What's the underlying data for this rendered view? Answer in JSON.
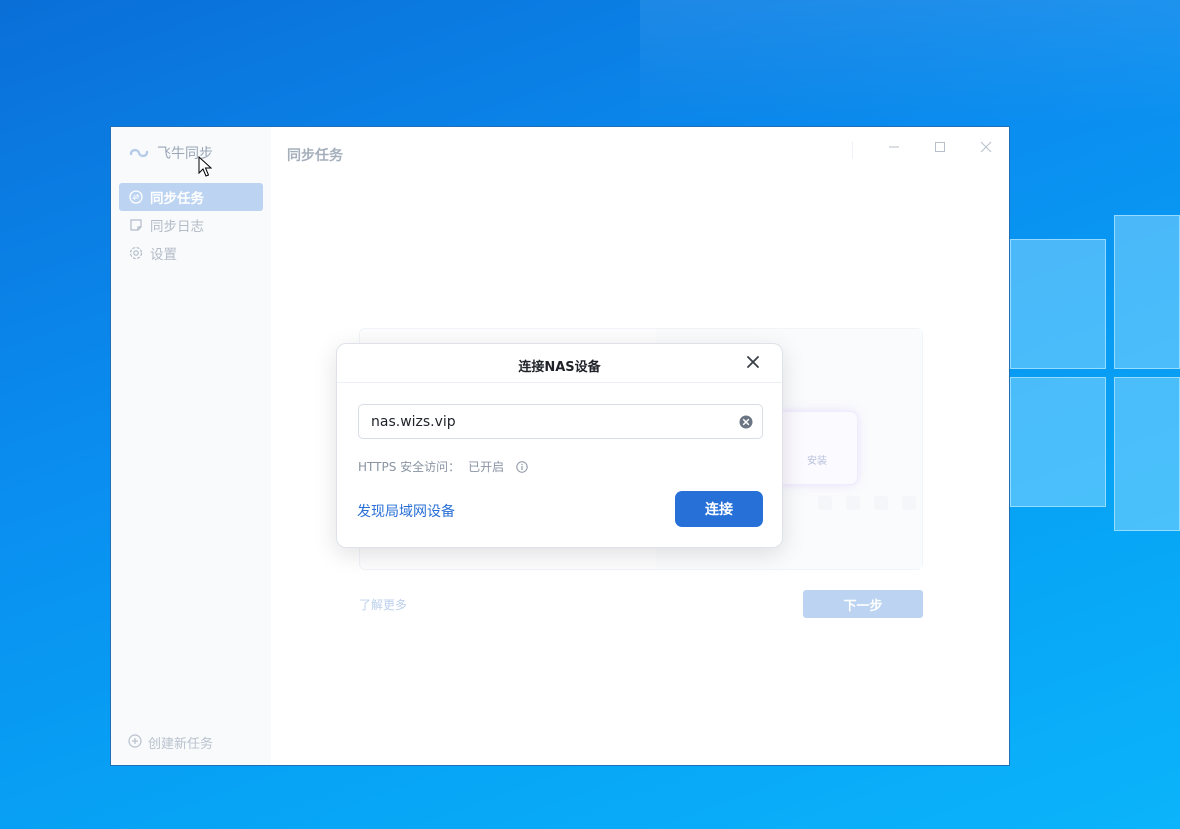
{
  "colors": {
    "accent": "#2670d8",
    "accent_light": "#bcd3f1",
    "link": "#2a6fd6",
    "desktop": "#0a8ef0"
  },
  "app": {
    "name": "飞牛同步",
    "page_title": "同步任务"
  },
  "sidebar": {
    "items": [
      {
        "label": "同步任务",
        "icon": "sync-icon",
        "active": true
      },
      {
        "label": "同步日志",
        "icon": "log-icon",
        "active": false
      },
      {
        "label": "设置",
        "icon": "gear-icon",
        "active": false
      }
    ],
    "new_task_label": "创建新任务"
  },
  "window_controls": [
    "minimize-icon",
    "maximize-icon",
    "close-icon"
  ],
  "background": {
    "install_label": "安装",
    "learn_more": "了解更多",
    "next_button": "下一步"
  },
  "dialog": {
    "title": "连接NAS设备",
    "input_value": "nas.wizs.vip",
    "https_label": "HTTPS 安全访问：",
    "https_status": "已开启",
    "discover_link": "发现局域网设备",
    "connect_button": "连接"
  }
}
